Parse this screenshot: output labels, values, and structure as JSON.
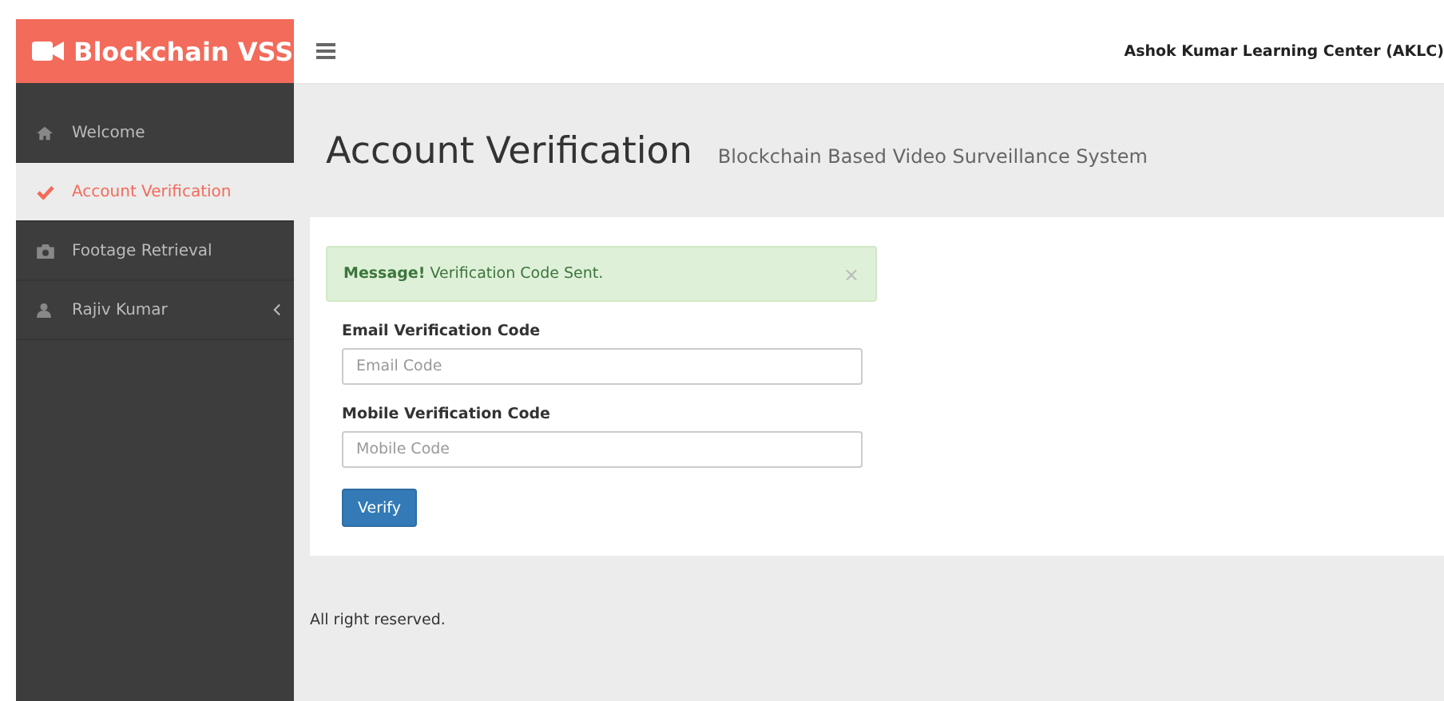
{
  "brand": {
    "title": "Blockchain VSS"
  },
  "header": {
    "organization": "Ashok Kumar Learning Center (AKLC)"
  },
  "sidebar": {
    "items": [
      {
        "label": "Welcome",
        "selected": false,
        "has_submenu": false
      },
      {
        "label": "Account Verification",
        "selected": true,
        "has_submenu": false
      },
      {
        "label": "Footage Retrieval",
        "selected": false,
        "has_submenu": false
      },
      {
        "label": "Rajiv Kumar",
        "selected": false,
        "has_submenu": true
      }
    ]
  },
  "page": {
    "title": "Account Verification",
    "subtitle": "Blockchain Based Video Surveillance System"
  },
  "alert": {
    "text": "**Message!** Verification Code Sent.",
    "close": "×"
  },
  "form": {
    "fields": [
      {
        "label": "Email Verification Code",
        "placeholder": "Email Code"
      },
      {
        "label": "Mobile Verification Code",
        "placeholder": "Mobile Code"
      }
    ],
    "button": "Verify"
  },
  "footer": {
    "text": "All right reserved."
  }
}
